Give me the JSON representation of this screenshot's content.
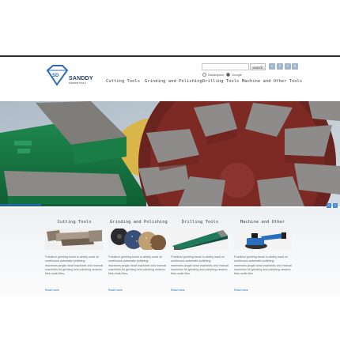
{
  "brand": {
    "name": "SANDDY",
    "tagline": "DIAMOND TOOLS",
    "mark": "SD"
  },
  "search": {
    "placeholder": "",
    "button_label": "search",
    "options": [
      "Sanddytool",
      "Google"
    ]
  },
  "nav": {
    "items": [
      "Cutting Tools",
      "Grinding and Polishing",
      "Drilling Tools",
      "Machine and Other Tools"
    ]
  },
  "social": {
    "icons": [
      "share-icon",
      "twitter-icon",
      "rss-icon",
      "network-icon"
    ]
  },
  "banner": {
    "prev": "‹",
    "next": "›"
  },
  "products": [
    {
      "title": "Cutting Tools",
      "description": "Frankfurt grinding brush is widely used on continuous automatic polishing machines,single-head machines and manual machines for grinding and polishing ceramic tiles,rustic tiles.",
      "more": "Read more"
    },
    {
      "title": "Grinding and Polishing",
      "description": "Frankfurt grinding brush is widely used on continuous automatic polishing machines,single-head machines and manual machines for grinding and polishing ceramic tiles,rustic tiles.",
      "more": "Read more"
    },
    {
      "title": "Drilling Tools",
      "description": "Frankfurt grinding brush is widely used on continuous automatic polishing machines,single-head machines and manual machines for grinding and polishing ceramic tiles,rustic tiles.",
      "more": "Read more"
    },
    {
      "title": "Machine and Other",
      "description": "Frankfurt grinding brush is widely used on continuous automatic polishing machines,single-head machines and manual machines for grinding and polishing ceramic tiles,rustic tiles.",
      "more": "Read more"
    }
  ],
  "colors": {
    "brand": "#233a66",
    "link": "#1e6dba",
    "banner_green": "#1a7a45",
    "banner_red": "#7d2a25"
  }
}
